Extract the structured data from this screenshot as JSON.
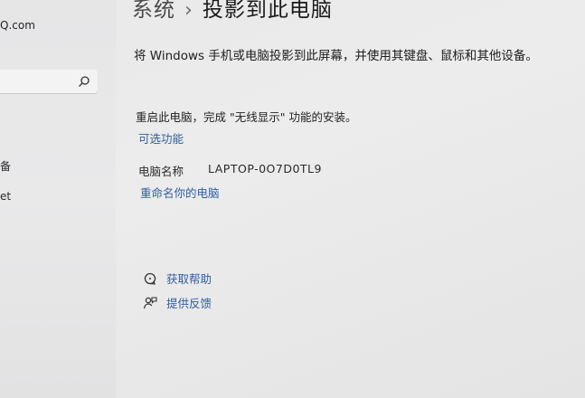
{
  "sidebar": {
    "account_email": "Q.com",
    "search": {
      "placeholder": ""
    },
    "items": [
      {
        "label": "备"
      },
      {
        "label": "et"
      }
    ]
  },
  "header": {
    "breadcrumb_parent": "系统",
    "breadcrumb_separator": "›",
    "page_title": "投影到此电脑"
  },
  "main": {
    "description": "将 Windows 手机或电脑投影到此屏幕，并使用其键盘、鼠标和其他设备。",
    "restart_notice": "重启此电脑，完成 \"无线显示\" 功能的安装。",
    "optional_features_link": "可选功能",
    "pc_name_label": "电脑名称",
    "pc_name_value": "LAPTOP-0O7D0TL9",
    "rename_link": "重命名你的电脑",
    "get_help": "获取帮助",
    "give_feedback": "提供反馈"
  },
  "colors": {
    "link": "#2f5f9e",
    "background": "#e9e9ea"
  }
}
